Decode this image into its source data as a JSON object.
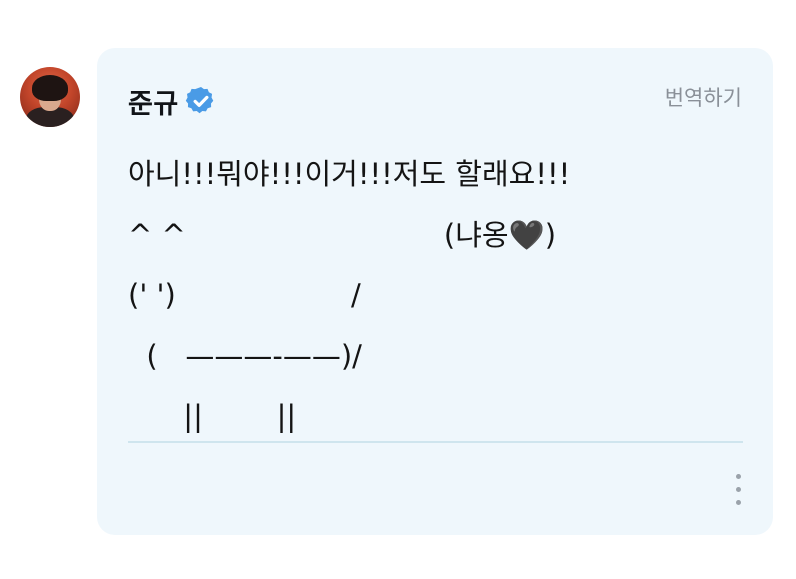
{
  "post": {
    "author": {
      "name": "준규",
      "verified_icon": "verified-check-icon",
      "avatar_icon": "profile-photo"
    },
    "translate_label": "번역하기",
    "body": "아니!!!뭐야!!!이거!!!저도 할래요!!!\n^ ^                            (냐옹🖤)\n(' ')                   /\n  (   ———-——)/\n      ||        ||",
    "more_icon": "more-vertical-icon"
  },
  "colors": {
    "card_background": "#eff7fc",
    "verified_badge": "#4a9be6",
    "text": "#141414",
    "muted_text": "#8a9098",
    "divider": "#cfe5ee"
  }
}
